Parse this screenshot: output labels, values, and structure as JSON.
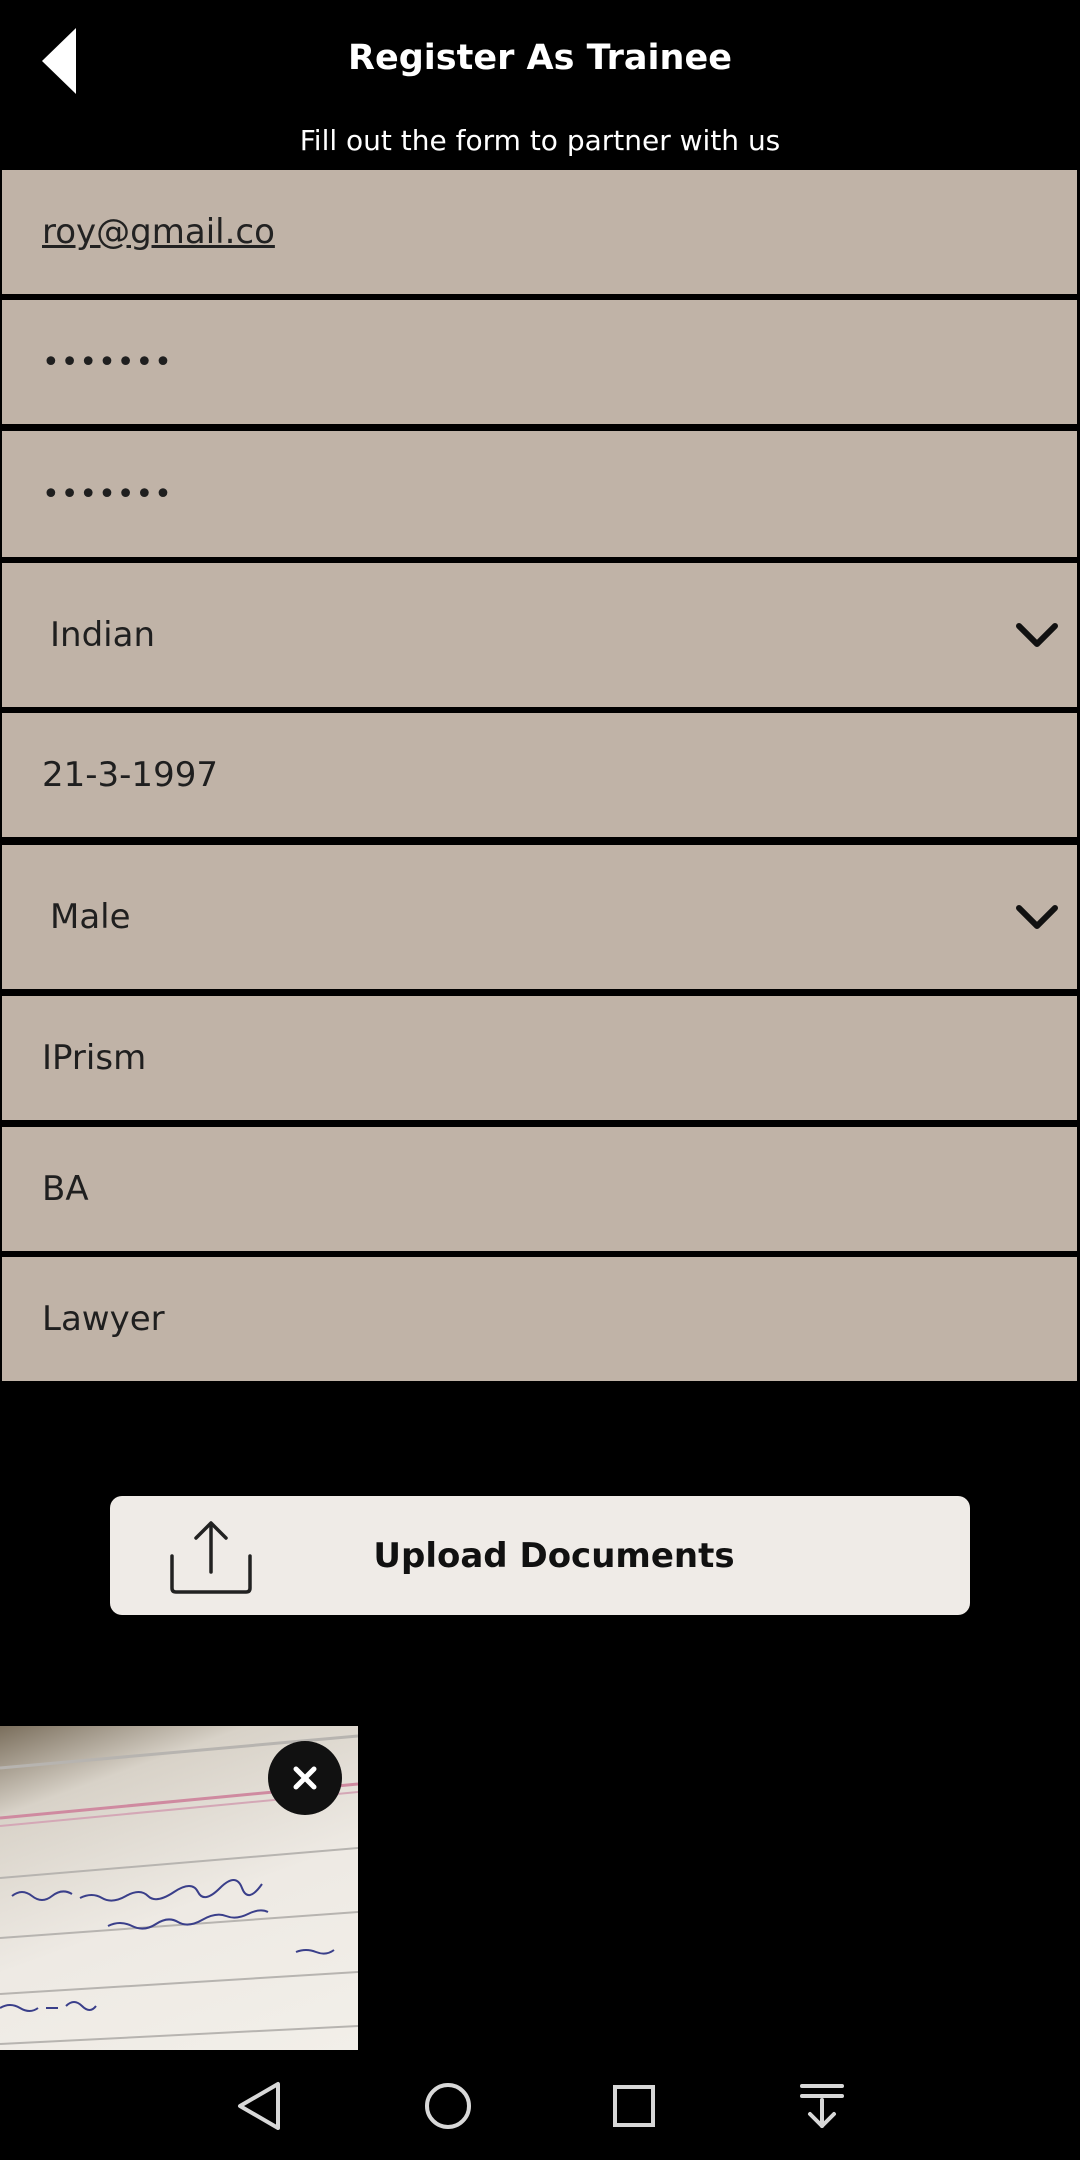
{
  "header": {
    "title": "Register As Trainee",
    "subtitle": "Fill out the form to partner with us"
  },
  "form": {
    "email": "roy@gmail.co",
    "password": "•••••••",
    "confirm_password": "•••••••",
    "nationality": "Indian",
    "dob": "21-3-1997",
    "gender": "Male",
    "organization": "IPrism",
    "qualification": "BA",
    "occupation": "Lawyer"
  },
  "upload": {
    "label": "Upload Documents"
  },
  "icons": {
    "back": "back-arrow-icon",
    "chevron": "chevron-down-icon",
    "upload": "upload-icon",
    "close": "close-icon",
    "nav_back": "nav-back-icon",
    "nav_home": "nav-home-icon",
    "nav_recents": "nav-recents-icon",
    "nav_notifications": "nav-notification-pulldown-icon"
  },
  "colors": {
    "background": "#000000",
    "field_bg": "#c0b3a7",
    "button_bg": "#efebe7"
  }
}
